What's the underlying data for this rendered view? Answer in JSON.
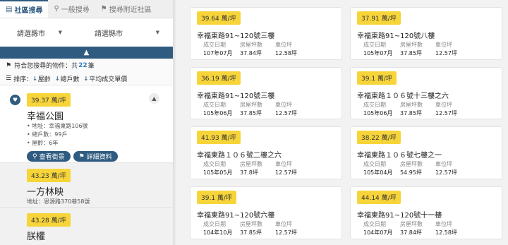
{
  "tabs": [
    {
      "label": "社區搜尋",
      "icon": "building-icon"
    },
    {
      "label": "一般搜尋",
      "icon": "search-icon"
    },
    {
      "label": "搜尋附近社區",
      "icon": "location-pin-icon"
    }
  ],
  "filters": {
    "county_label": "請選縣市",
    "district_label": "請選縣市"
  },
  "results": {
    "prefix": "符合您搜尋的物件：共",
    "count": "22",
    "suffix": "筆"
  },
  "sort": {
    "label": "排序：",
    "options": [
      "屋齡",
      "總戶數",
      "平均成交單價"
    ]
  },
  "communities": [
    {
      "price": "39.37 萬/坪",
      "name": "幸福公園",
      "address": "地址：幸福東路106號",
      "households": "總戶數：99戶",
      "age": "屋齡：6年",
      "street_view_btn": "查看街景",
      "details_btn": "詳細資料"
    },
    {
      "price": "43.23 萬/坪",
      "name": "一方林映",
      "address": "地址：恩源路370巷58號"
    },
    {
      "price": "43.28 萬/坪",
      "name": "朕權"
    }
  ],
  "listing_labels": {
    "date": "成交日期",
    "area": "房屋坪數",
    "parking": "車位坪"
  },
  "listings": [
    {
      "price": "39.64 萬/坪",
      "address": "幸福東路91~120號三樓",
      "date": "107年07月",
      "area": "37.84坪",
      "parking": "12.58坪"
    },
    {
      "price": "37.91 萬/坪",
      "address": "幸福東路91~120號八樓",
      "date": "105年07月",
      "area": "37.85坪",
      "parking": "12.57坪"
    },
    {
      "price": "36.19 萬/坪",
      "address": "幸福東路91~120號三樓",
      "date": "105年06月",
      "area": "37.85坪",
      "parking": "12.57坪"
    },
    {
      "price": "39.1 萬/坪",
      "address": "幸福東路１０６號十三樓之六",
      "date": "105年06月",
      "area": "37.85坪",
      "parking": "12.57坪"
    },
    {
      "price": "41.93 萬/坪",
      "address": "幸福東路１０６號二樓之六",
      "date": "105年05月",
      "area": "37.8坪",
      "parking": "12.57坪"
    },
    {
      "price": "38.22 萬/坪",
      "address": "幸福東路１０６號七樓之一",
      "date": "105年04月",
      "area": "54.95坪",
      "parking": "12.57坪"
    },
    {
      "price": "39.1 萬/坪",
      "address": "幸福東路91~120號六樓",
      "date": "104年10月",
      "area": "37.85坪",
      "parking": "12.57坪"
    },
    {
      "price": "44.14 萬/坪",
      "address": "幸福東路91~120號十一樓",
      "date": "104年07月",
      "area": "37.84坪",
      "parking": "12.58坪"
    }
  ],
  "colors": {
    "accent": "#2f5b80",
    "price_badge": "#f7d53a",
    "count": "#2f7fc1"
  }
}
